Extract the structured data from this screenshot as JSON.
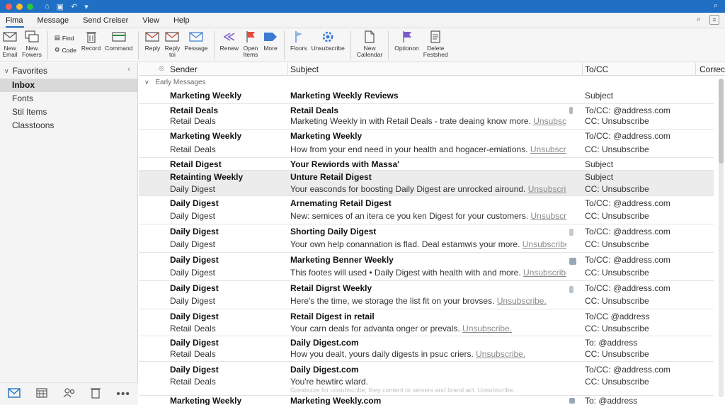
{
  "menu": {
    "tabs": [
      "Fima",
      "Message",
      "Send Creiser",
      "View",
      "Help"
    ]
  },
  "ribbon": {
    "new_email": [
      "New",
      "Email"
    ],
    "new_fowers": [
      "New",
      "Fowers"
    ],
    "find": "Find",
    "code": "Code",
    "record": "Record",
    "command": "Command",
    "reply": "Reply",
    "reply_toi": [
      "Reply",
      "toi"
    ],
    "pessage": "Pessage",
    "renew": "Renew",
    "open_items": [
      "Open",
      "Items"
    ],
    "more": "More",
    "floors": "Floors",
    "unsubscribe": "Unsubscribe",
    "new_calendar": [
      "New",
      "Callendar"
    ],
    "optionon": "Optionon",
    "delete_festshed": [
      "Delete",
      "Festshed"
    ]
  },
  "sidebar": {
    "favorites": "Favorites",
    "items": [
      "Inbox",
      "Fonts",
      "Stil Items",
      "Classtoons"
    ]
  },
  "list": {
    "columns": {
      "sender": "Sender",
      "subject": "Subject",
      "tocc": "To/CC",
      "correct": "Correct"
    },
    "group": "Early Messages",
    "rows": [
      {
        "s1": "Marketing Weekly",
        "s2": "",
        "t1": "Marketing Weekly Reviews",
        "t2": "",
        "u": "",
        "c1": "Subject",
        "c2": ""
      },
      {
        "s1": "Retail Deals",
        "s2": "Retail Deals",
        "t1": "Retail Deals",
        "t2": "Marketing Weekly in with Retail Deals - trate deaing know more.",
        "u": "Unsubscribe.",
        "c1": "To/CC: @address.com",
        "c2": "CC: Unsubscribe"
      },
      {
        "s1": "Marketing Weekly",
        "s2": "Retail Deals",
        "t1": "Marketing Weekly",
        "t2": "How from your end need in your health and hogacer-emiations.",
        "u": "Unsubscribe.",
        "c1": "To/CC: @address.com",
        "c2": "CC: Unsubscribe"
      },
      {
        "s1": "Retail Digest",
        "s2": "",
        "t1": "Your Rewiords with Massa'",
        "t2": "",
        "u": "",
        "c1": "Subject",
        "c2": ""
      },
      {
        "s1": "Retainting Weekly",
        "s2": "Daily Digest",
        "t1": "Unture Retail Digest",
        "t2": "Your easconds for boosting Daily Digest are unrocked airound.",
        "u": "Unsubscribe.",
        "c1": "Subject",
        "c2": "CC: Unsubscribe"
      },
      {
        "s1": "Daily Digest",
        "s2": "Daily Digest",
        "t1": "Arnemating Retail Digest",
        "t2": "New: semices of an itera ce you ken Digest for your customers.",
        "u": "Unsubscribe.",
        "c1": "To/CC: @address.com",
        "c2": "CC: Unsubscribe"
      },
      {
        "s1": "Daily Digest",
        "s2": "Daily Digest",
        "t1": "Shorting Daily Digest",
        "t2": "Your own help conannation is flad. Deal estamwis your more.",
        "u": "Unsubscribe.",
        "c1": "To/CC: @address.com",
        "c2": "CC: Unsubscribe"
      },
      {
        "s1": "Daily Digest",
        "s2": "Daily Digest",
        "t1": "Marketing Benner Weekly",
        "t2": "This footes will used • Daily Digest with health with and more.",
        "u": "Unsubscribe.",
        "c1": "To/CC: @address.com",
        "c2": "CC: Unsubscribe"
      },
      {
        "s1": "Daily Digest",
        "s2": "Daily Digest",
        "t1": "Retail Digrst Weekly",
        "t2": "Here's the time, we storage the list fit on your brovses.",
        "u": "Unsubscribe.",
        "c1": "To/CC: @address.com",
        "c2": "CC: Unsubscribe"
      },
      {
        "s1": "Daily Digest",
        "s2": "Retail Deals",
        "t1": "Retail Digest in retail",
        "t2": "Your carn deals for advanta onger or prevals.",
        "u": "Unsubscribe.",
        "c1": "To/CC @address",
        "c2": "CC: Unsubscribe"
      },
      {
        "s1": "Daily Digest",
        "s2": "Retail Deals",
        "t1": "Daily Digest.com",
        "t2": "How you dealt, yours daily digests in psuc criers.",
        "u": "Unsubscribe.",
        "c1": "To: @address",
        "c2": "CC: Unsubscribe"
      },
      {
        "s1": "Daily Digest",
        "s2": "Retail Deals",
        "t1": "Daily Digest.com",
        "t2": "You're hewtirc wlard.",
        "u": "",
        "c1": "To/CC: @address.com",
        "c2": "CC: Unsubscribe"
      },
      {
        "s1": "Marketing Weekly",
        "s2": "",
        "t1": "Marketing Weekly.com",
        "t2": "",
        "u": "",
        "c1": "To: @address",
        "c2": ""
      }
    ],
    "faded_line": "Greatezze for unsubscribe, they content or servers and brand act. Unsubscribe."
  },
  "colors": {
    "accent": "#1f6fc4",
    "flag_purple": "#7b5cc6",
    "flag_red": "#e04b3c",
    "grey_tile": "#9aa7b4"
  }
}
